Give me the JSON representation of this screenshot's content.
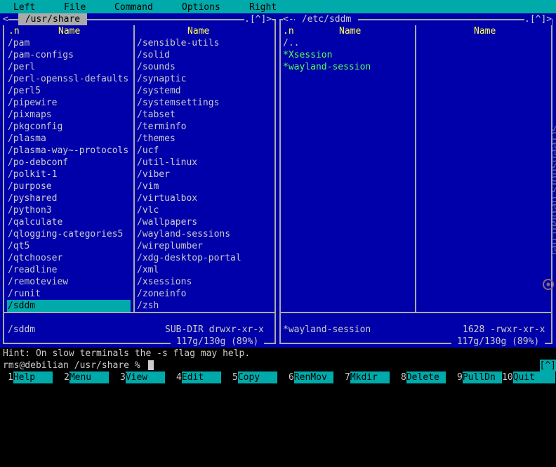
{
  "menu": [
    "Left",
    "File",
    "Command",
    "Options",
    "Right"
  ],
  "left_panel": {
    "title": " /usr/share ",
    "corner": ".[^]>",
    "corner_left": "<",
    "sort": ".n",
    "col_header": "Name",
    "col1": [
      "/pam",
      "/pam-configs",
      "/perl",
      "/perl-openssl-defaults",
      "/perl5",
      "/pipewire",
      "/pixmaps",
      "/pkgconfig",
      "/plasma",
      "/plasma-way~-protocols",
      "/po-debconf",
      "/polkit-1",
      "/purpose",
      "/pyshared",
      "/python3",
      "/qalculate",
      "/qlogging-categories5",
      "/qt5",
      "/qtchooser",
      "/readline",
      "/remoteview",
      "/runit",
      "/sddm"
    ],
    "col2": [
      "/sensible-utils",
      "/solid",
      "/sounds",
      "/synaptic",
      "/systemd",
      "/systemsettings",
      "/tabset",
      "/terminfo",
      "/themes",
      "/ucf",
      "/util-linux",
      "/viber",
      "/vim",
      "/virtualbox",
      "/vlc",
      "/wallpapers",
      "/wayland-sessions",
      "/wireplumber",
      "/xdg-desktop-portal",
      "/xml",
      "/xsessions",
      "/zoneinfo",
      "/zsh"
    ],
    "status_name": "/sddm",
    "status_info": "SUB-DIR drwxr-xr-x",
    "disk": " 117g/130g (89%) "
  },
  "right_panel": {
    "title": " /etc/sddm ",
    "corner_left": "<-",
    "corner": ".[^]>",
    "sort": ".n",
    "col_header": "Name",
    "items": [
      {
        "name": "/..",
        "type": "dir"
      },
      {
        "name": "*Xsession",
        "type": "exec"
      },
      {
        "name": "*wayland-session",
        "type": "exec"
      }
    ],
    "status_name": "*wayland-session",
    "status_info": "1628 -rwxr-xr-x",
    "disk": " 117g/130g (89%) "
  },
  "hint": "Hint: On slow terminals the -s flag may help.",
  "prompt": "rms@debilian /usr/share % ",
  "updown": "[^]",
  "fkeys": [
    {
      "num": "1",
      "label": "Help"
    },
    {
      "num": "2",
      "label": "Menu"
    },
    {
      "num": "3",
      "label": "View"
    },
    {
      "num": "4",
      "label": "Edit"
    },
    {
      "num": "5",
      "label": "Copy"
    },
    {
      "num": "6",
      "label": "RenMov"
    },
    {
      "num": "7",
      "label": "Mkdir"
    },
    {
      "num": "8",
      "label": "Delete"
    },
    {
      "num": "9",
      "label": "PullDn"
    },
    {
      "num": "10",
      "label": "Quit"
    }
  ],
  "watermark": "screenshots.debian.net",
  "colors": {
    "panel_bg": "#0000aa",
    "selection": "#00aaaa",
    "header": "#ffff55",
    "exec": "#55ff55"
  }
}
